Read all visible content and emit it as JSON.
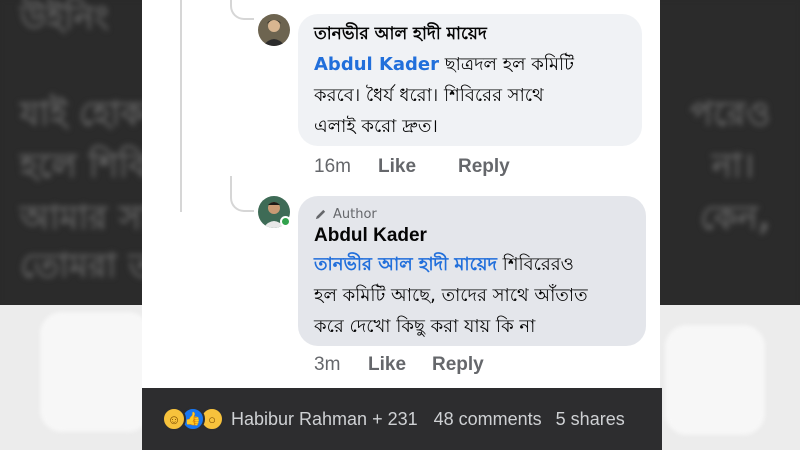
{
  "background": {
    "lines": [
      "উইনিং",
      "যাই হোক",
      "হলে শিবি",
      "আমার সা",
      "তোমরা ত"
    ],
    "right_fragments": [
      "পরেও",
      "না।",
      "কেন,"
    ]
  },
  "comment1": {
    "author": "তানভীর আল হাদী মায়েদ",
    "mention": "Abdul Kader",
    "text": "ছাত্রদল হল কমিটি করবে। ধৈর্য ধরো। শিবিরের সাথে এলাই করো দ্রুত।",
    "lines": [
      "ছাত্রদল হল কমিটি",
      "করবে। ধৈর্য ধরো। শিবিরের সাথে",
      "এলাই করো দ্রুত।"
    ],
    "time": "16m",
    "like_label": "Like",
    "reply_label": "Reply"
  },
  "comment2": {
    "badge": "Author",
    "author": "Abdul Kader",
    "mention": "তানভীর আল হাদী মায়েদ",
    "text": "শিবিরেরও হল কমিটি আছে, তাদের সাথে আঁতাত করে দেখো কিছু করা যায় কি না",
    "lines": [
      "শিবিরেরও",
      "হল কমিটি আছে, তাদের সাথে আঁতাত",
      "করে দেখো কিছু করা যায় কি না"
    ],
    "time": "3m",
    "like_label": "Like",
    "reply_label": "Reply"
  },
  "footer": {
    "reactions": [
      "haha",
      "like",
      "wow"
    ],
    "reactors": "Habibur Rahman + 231",
    "comments": "48 comments",
    "shares": "5 shares"
  },
  "colors": {
    "mention": "#216fdb",
    "bubble_light": "#f0f2f5",
    "bubble_dark": "#e4e6eb",
    "footer_bg": "#2d2d2f",
    "online": "#31a24c"
  }
}
